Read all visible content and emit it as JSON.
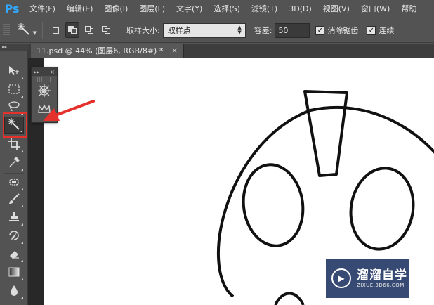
{
  "app": {
    "logo": "Ps"
  },
  "menu": [
    "文件(F)",
    "编辑(E)",
    "图像(I)",
    "图层(L)",
    "文字(Y)",
    "选择(S)",
    "滤镜(T)",
    "3D(D)",
    "视图(V)",
    "窗口(W)",
    "帮助"
  ],
  "options": {
    "sample_size_label": "取样大小:",
    "sample_size_value": "取样点",
    "tolerance_label": "容差:",
    "tolerance_value": "50",
    "antialias_label": "消除锯齿",
    "contiguous_label": "连续"
  },
  "document": {
    "tab_title": "11.psd @ 44% (图层6, RGB/8#) *",
    "close_symbol": "×"
  },
  "flyout": {
    "collapse": "▸▸",
    "close": "×"
  },
  "watermark": {
    "name": "溜溜自学",
    "url": "ZIXUE.3D66.COM"
  },
  "colors": {
    "highlight": "#e4312b",
    "ps_blue": "#31a8ff",
    "ui_gray": "#535353"
  }
}
